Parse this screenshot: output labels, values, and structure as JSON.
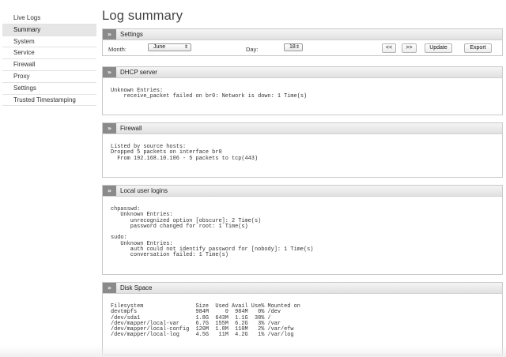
{
  "sidebar": {
    "items": [
      {
        "label": "Live Logs"
      },
      {
        "label": "Summary"
      },
      {
        "label": "System"
      },
      {
        "label": "Service"
      },
      {
        "label": "Firewall"
      },
      {
        "label": "Proxy"
      },
      {
        "label": "Settings"
      },
      {
        "label": "Trusted Timestamping"
      }
    ],
    "active": "Summary"
  },
  "page": {
    "title": "Log summary"
  },
  "icons": {
    "panel_toggle": "double-chevron-right-icon",
    "select_arrows": "up-down-arrows-icon"
  },
  "settings": {
    "title": "Settings",
    "month_label": "Month:",
    "month_value": "June",
    "day_label": "Day:",
    "day_value": "18",
    "prev_label": "<<",
    "next_label": ">>",
    "update_label": "Update",
    "export_label": "Export"
  },
  "dhcp": {
    "title": "DHCP server",
    "log": "Unknown Entries:\n    receive_packet failed on br0: Network is down: 1 Time(s)"
  },
  "firewall": {
    "title": "Firewall",
    "log": "Listed by source hosts:\nDropped 5 packets on interface br0\n  From 192.168.10.106 - 5 packets to tcp(443)"
  },
  "logins": {
    "title": "Local user logins",
    "log": "chpasswd:\n   Unknown Entries:\n      unrecognized option [obscure]: 2 Time(s)\n      password changed for root: 1 Time(s)\n\nsudo:\n   Unknown Entries:\n      auth could not identify password for [nobody]: 1 Time(s)\n      conversation failed: 1 Time(s)"
  },
  "disk": {
    "title": "Disk Space",
    "log": "Filesystem                Size  Used Avail Use% Mounted on\ndevtmpfs                  984M     0  984M   0% /dev\n/dev/sda1                 1.8G  643M  1.1G  38% /\n/dev/mapper/local-var     6.7G  155M  6.2G   3% /var\n/dev/mapper/local-config  120M  1.8M  110M   2% /var/efw\n/dev/mapper/local-log     4.5G   11M  4.2G   1% /var/log"
  },
  "colors": {
    "active_nav_bg": "#e6e6e6",
    "panel_toggle_bg": "#8a8a8a"
  }
}
